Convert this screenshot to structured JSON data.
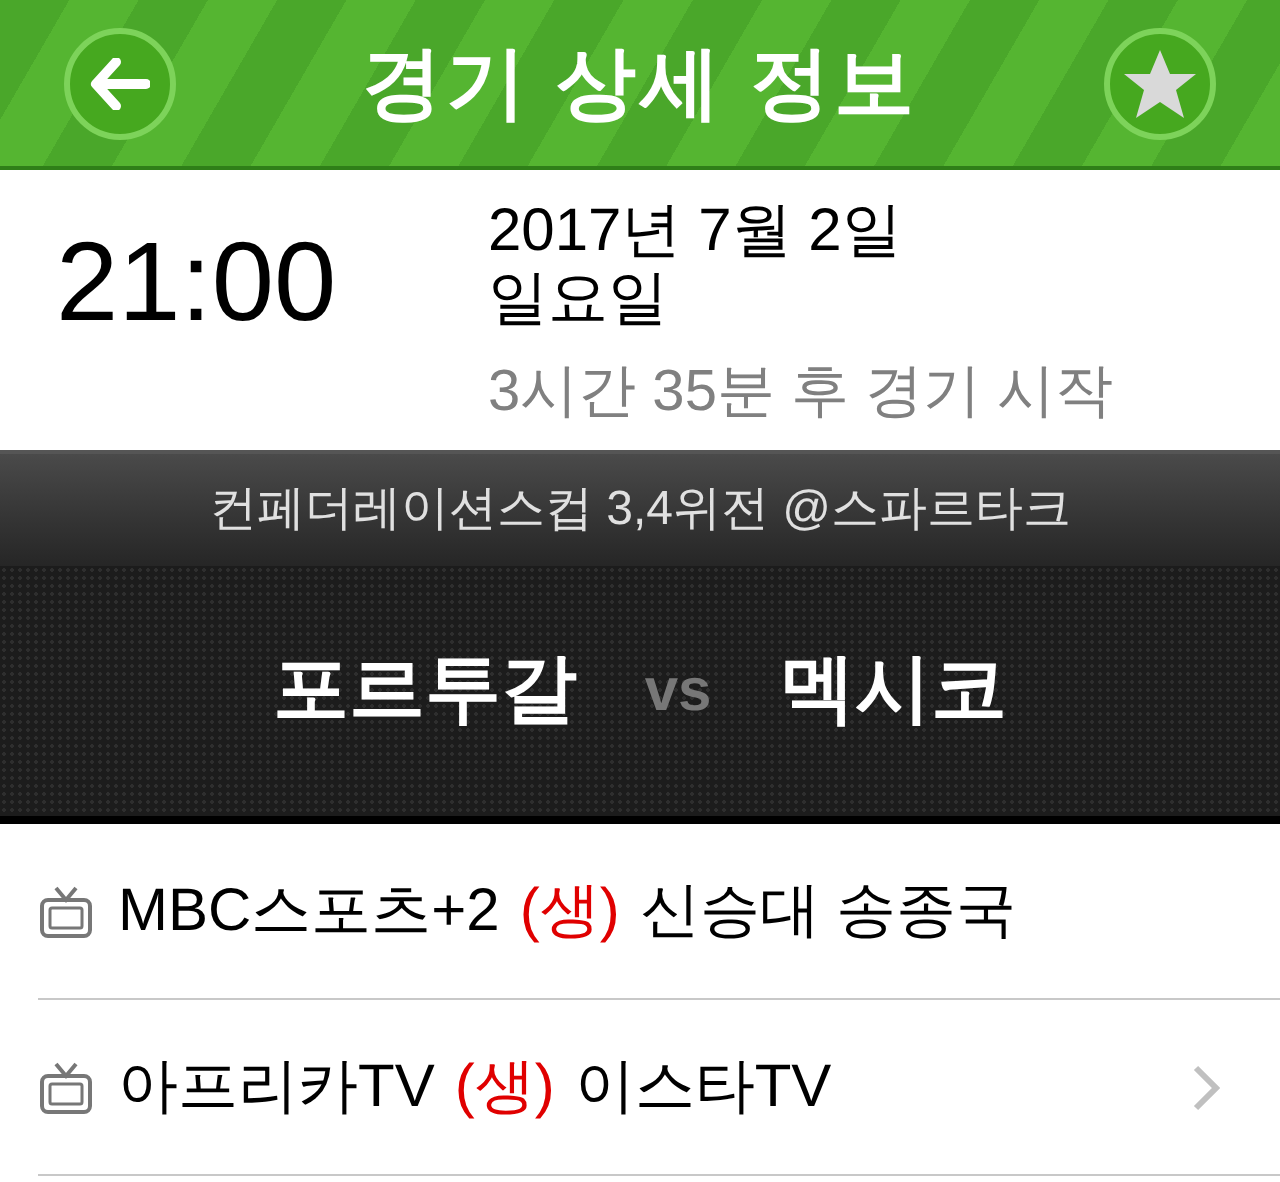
{
  "header": {
    "title": "경기 상세 정보",
    "favorite": false
  },
  "schedule": {
    "time": "21:00",
    "date": "2017년 7월 2일",
    "weekday": "일요일",
    "countdown": "3시간 35분 후 경기 시작"
  },
  "match": {
    "competition": "컨페더레이션스컵 3,4위전 @스파르타크",
    "home": "포르투갈",
    "vs": "vs",
    "away": "멕시코"
  },
  "broadcasts": [
    {
      "channel": "MBC스포츠+2",
      "live": "(생)",
      "commentators": "신승대 송종국",
      "has_link": false
    },
    {
      "channel": "아프리카TV",
      "live": "(생)",
      "commentators": "이스타TV",
      "has_link": true
    }
  ]
}
